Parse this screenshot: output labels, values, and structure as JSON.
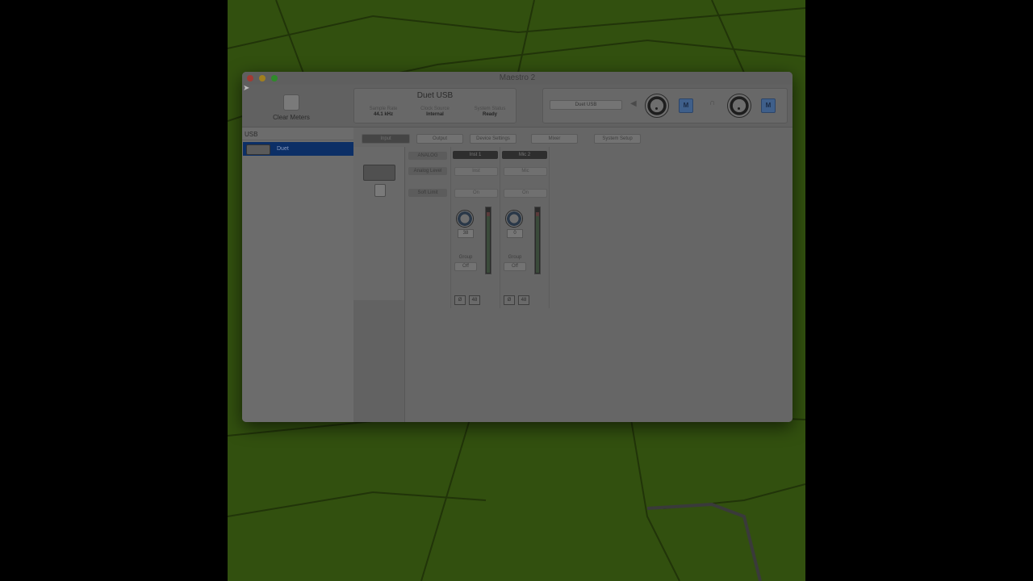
{
  "window": {
    "title": "Maestro 2"
  },
  "toolbar": {
    "clear_meters_label": "Clear Meters"
  },
  "device_info": {
    "name": "Duet USB",
    "columns": [
      {
        "label": "Sample Rate",
        "value": "44.1 kHz"
      },
      {
        "label": "Clock Source",
        "value": "Internal"
      },
      {
        "label": "System Status",
        "value": "Ready"
      }
    ]
  },
  "monitor": {
    "device_label": "Duet USB",
    "mute_label": "M",
    "mute2_label": "M"
  },
  "sidebar": {
    "header": "USB",
    "items": [
      {
        "label": "Duet"
      }
    ]
  },
  "tabs": [
    "Input",
    "Output",
    "Device Settings",
    "Mixer",
    "System Setup"
  ],
  "rows": {
    "analog": "ANALOG",
    "analog_level": "Analog Level",
    "soft_limit": "Soft Limit"
  },
  "channels": [
    {
      "name": "Inst 1",
      "level": "Inst",
      "soft_limit": "On",
      "gain": "38",
      "group_label": "Group",
      "group_value": "Off",
      "btn_a": "Ø",
      "btn_b": "48",
      "meter_fill": 0.92
    },
    {
      "name": "Mic 2",
      "level": "Mic",
      "soft_limit": "On",
      "gain": "0",
      "group_label": "Group",
      "group_value": "Off",
      "btn_a": "Ø",
      "btn_b": "48",
      "meter_fill": 0.92
    }
  ],
  "colors": {
    "selection": "#0c2f66",
    "mute": "#3f5f8a"
  }
}
